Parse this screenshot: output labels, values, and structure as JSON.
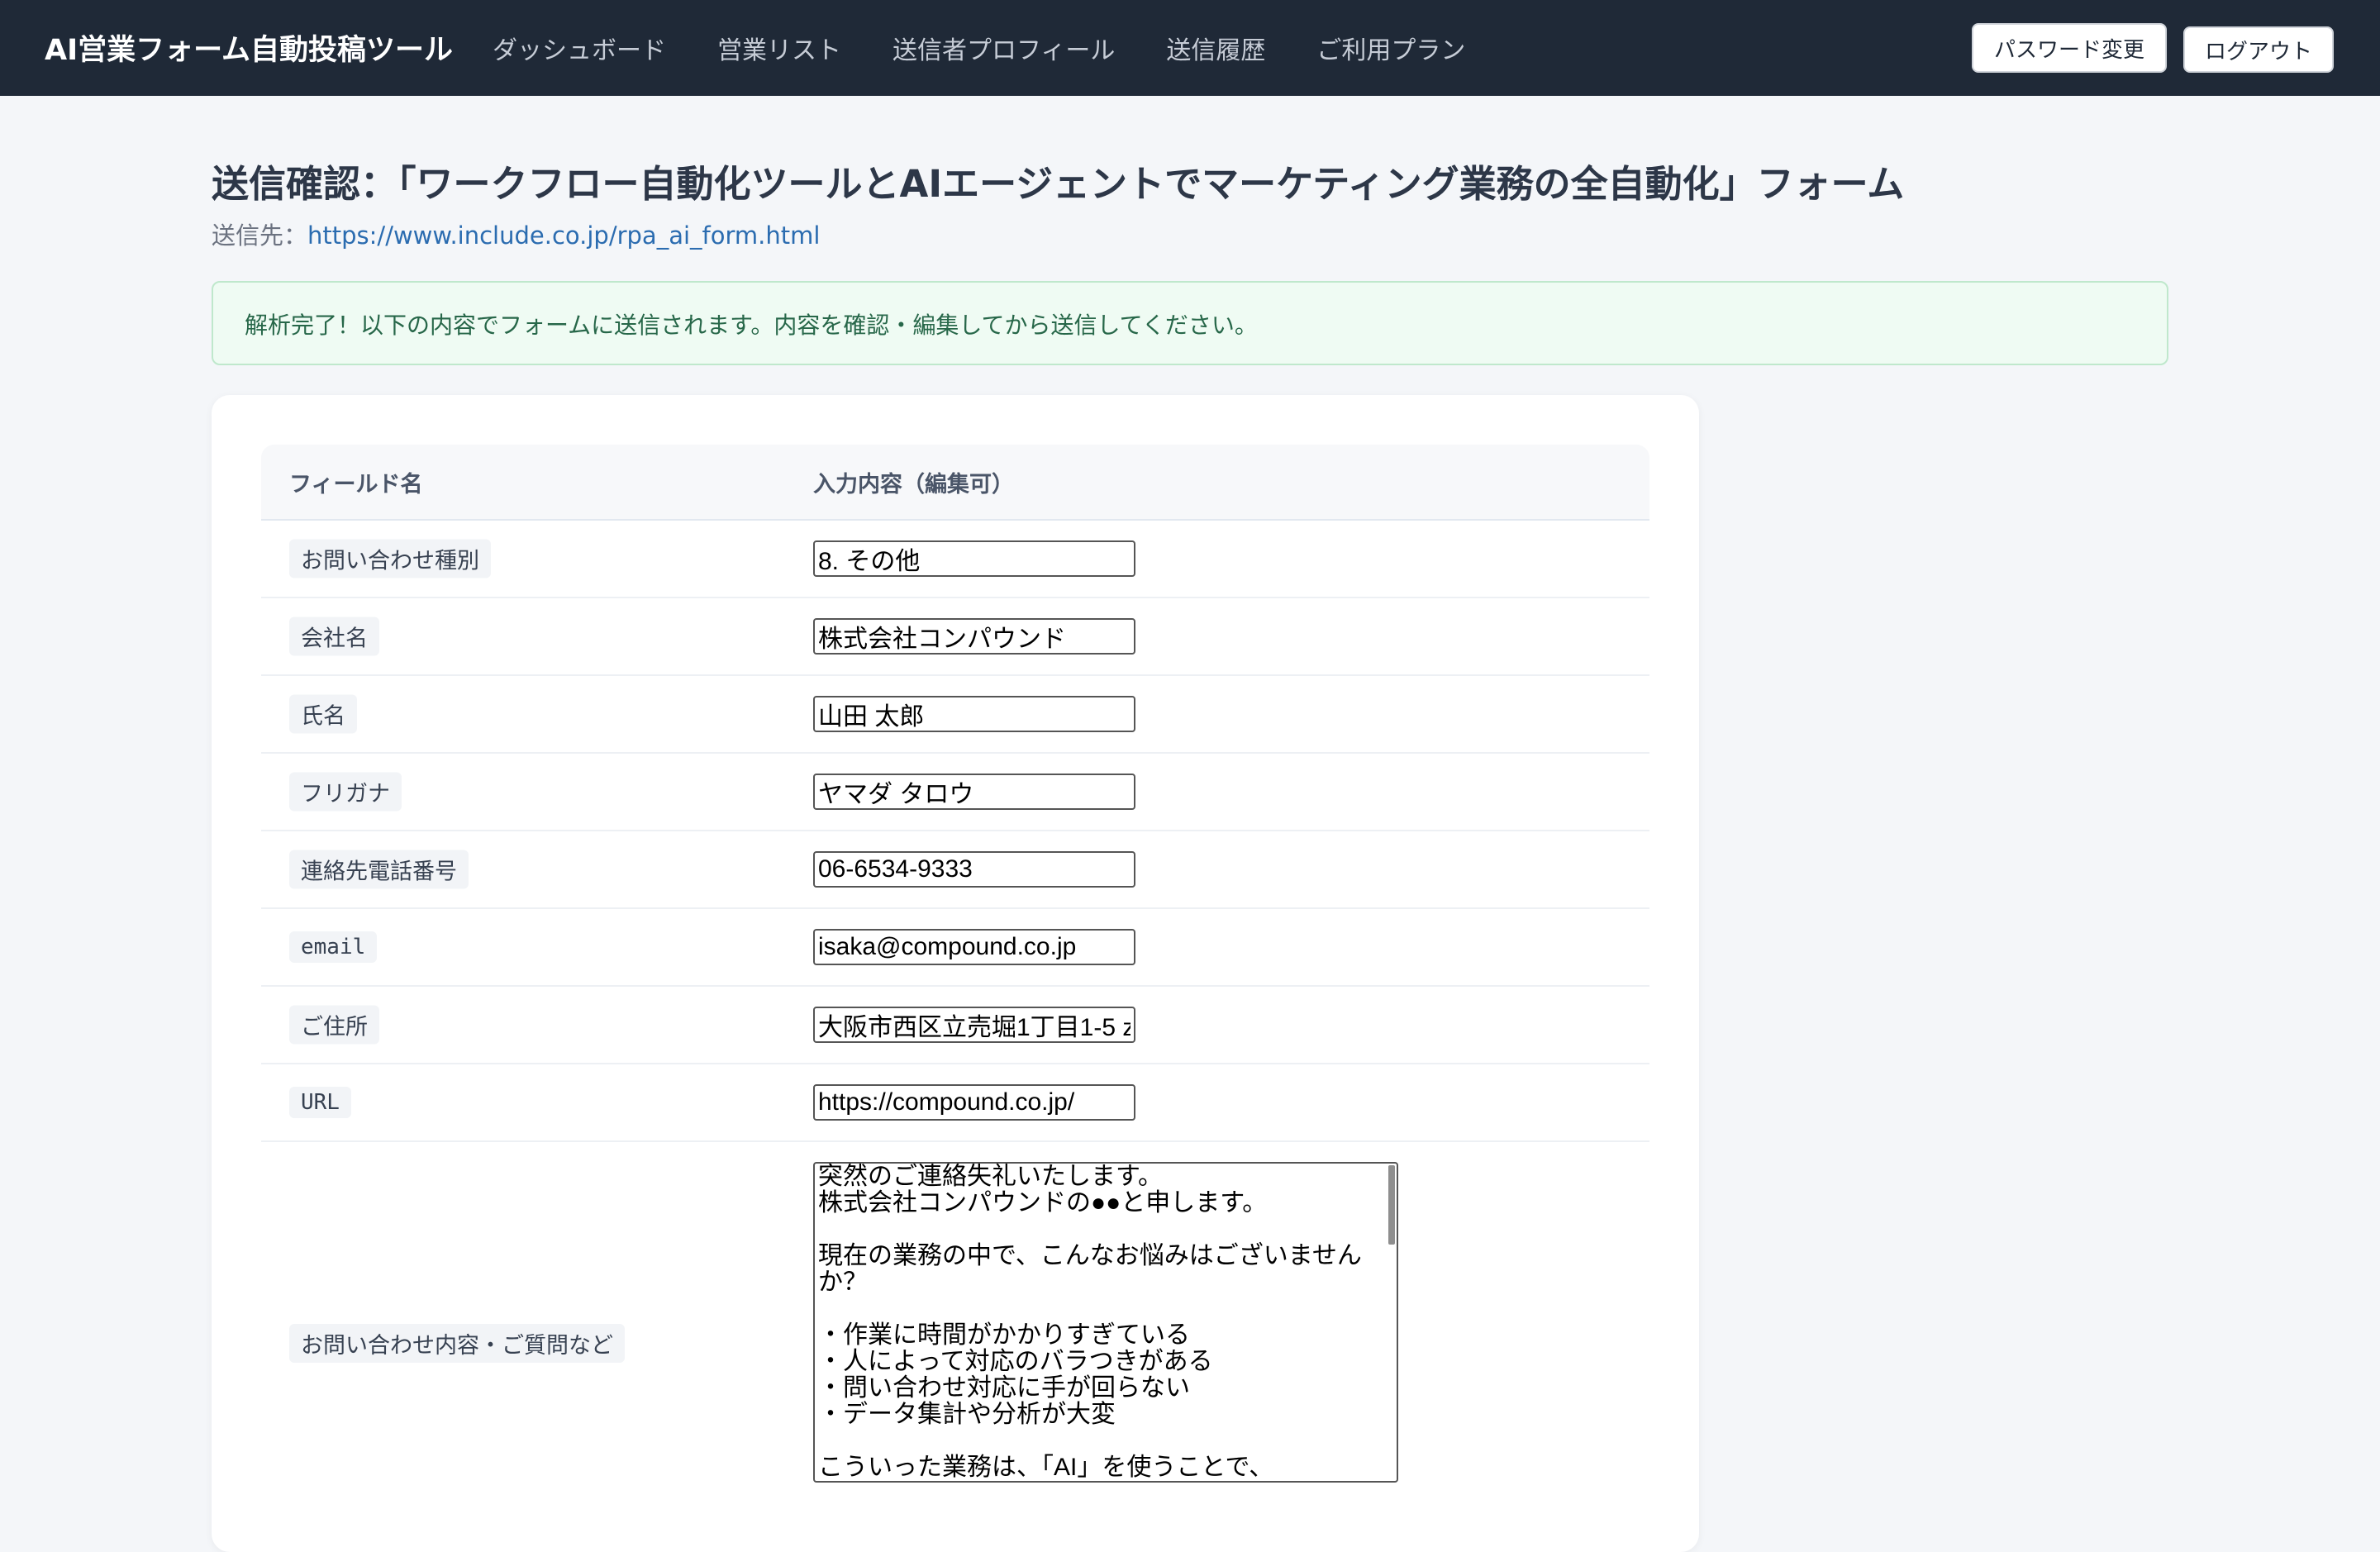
{
  "nav": {
    "brand": "AI営業フォーム自動投稿ツール",
    "links": [
      "ダッシュボード",
      "営業リスト",
      "送信者プロフィール",
      "送信履歴",
      "ご利用プラン"
    ],
    "password_button": "パスワード変更",
    "logout_button": "ログアウト"
  },
  "page": {
    "title": "送信確認：「ワークフロー自動化ツールとAIエージェントでマーケティング業務の全自動化」フォーム",
    "destination_label": "送信先：",
    "destination_url": "https://www.include.co.jp/rpa_ai_form.html"
  },
  "alert": {
    "message": "解析完了！以下の内容でフォームに送信されます。内容を確認・編集してから送信してください。"
  },
  "table": {
    "headers": {
      "field": "フィールド名",
      "value": "入力内容（編集可）"
    },
    "rows": [
      {
        "label": "お問い合わせ種別",
        "value": "8. その他"
      },
      {
        "label": "会社名",
        "value": "株式会社コンパウンド"
      },
      {
        "label": "氏名",
        "value": "山田 太郎"
      },
      {
        "label": "フリガナ",
        "value": "ヤマダ タロウ"
      },
      {
        "label": "連絡先電話番号",
        "value": "06-6534-9333"
      },
      {
        "label": "email",
        "value": "isaka@compound.co.jp"
      },
      {
        "label": "ご住所",
        "value": "大阪市西区立売堀1丁目1-5 z"
      },
      {
        "label": "URL",
        "value": "https://compound.co.jp/"
      }
    ],
    "message_row": {
      "label": "お問い合わせ内容・ご質問など",
      "value": "突然のご連絡失礼いたします。\n株式会社コンパウンドの●●と申します。\n\n現在の業務の中で、こんなお悩みはございませんか？\n\n・作業に時間がかかりすぎている\n・人によって対応のバラつきがある\n・問い合わせ対応に手が回らない\n・データ集計や分析が大変\n\nこういった業務は、「AI」を使うことで、"
    }
  }
}
